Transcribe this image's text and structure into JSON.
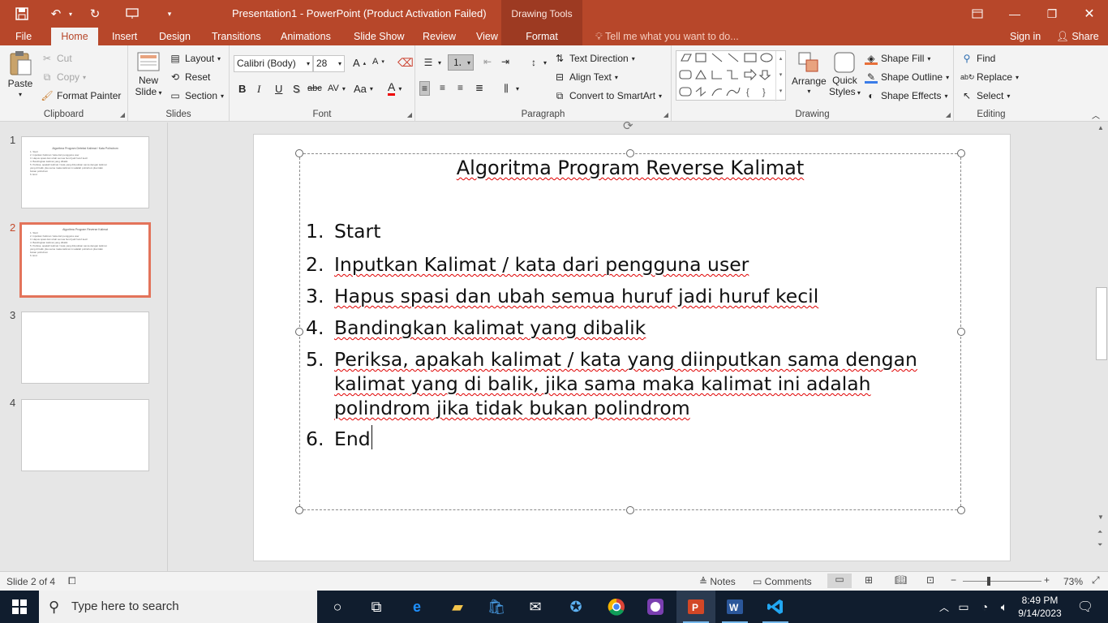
{
  "titlebar": {
    "title": "Presentation1 - PowerPoint (Product Activation Failed)",
    "context_tab_group": "Drawing Tools"
  },
  "tabs": [
    "File",
    "Home",
    "Insert",
    "Design",
    "Transitions",
    "Animations",
    "Slide Show",
    "Review",
    "View",
    "Format"
  ],
  "active_tab": "Home",
  "tell_me": "Tell me what you want to do...",
  "signin": "Sign in",
  "share": "Share",
  "ribbon": {
    "clipboard": {
      "label": "Clipboard",
      "paste": "Paste",
      "cut": "Cut",
      "copy": "Copy",
      "format_painter": "Format Painter"
    },
    "slides": {
      "label": "Slides",
      "new_slide_1": "New",
      "new_slide_2": "Slide",
      "layout": "Layout",
      "reset": "Reset",
      "section": "Section"
    },
    "font": {
      "label": "Font",
      "font_name": "Calibri (Body)",
      "font_size": "28",
      "bold": "B",
      "italic": "I",
      "underline": "U",
      "shadow": "S",
      "strike": "abc",
      "spacing": "AV",
      "case": "Aa",
      "color": "A",
      "grow": "A",
      "shrink": "A"
    },
    "paragraph": {
      "label": "Paragraph",
      "text_direction": "Text Direction",
      "align_text": "Align Text",
      "convert_smartart": "Convert to SmartArt"
    },
    "drawing": {
      "label": "Drawing",
      "arrange": "Arrange",
      "quick_styles_1": "Quick",
      "quick_styles_2": "Styles",
      "shape_fill": "Shape Fill",
      "shape_outline": "Shape Outline",
      "shape_effects": "Shape Effects"
    },
    "editing": {
      "label": "Editing",
      "find": "Find",
      "replace": "Replace",
      "select": "Select"
    }
  },
  "thumbnails": [
    {
      "num": "1",
      "title": "Algoritma Program Deteksi Kalimat / Kata Polindrom",
      "lines": [
        "1. Start",
        "2. Inputkan Kalimat / kata dari pengguna user",
        "3. Hapus spasi dan ubah semua huruf jadi huruf kecil",
        "4. Bandingkan kalimat yang dibalik",
        "5. Periksa, apakah kalimat / kata yang diinputkan sama dengan kalimat",
        "   yang di balik, jika sama maka kalimat ini adalah polindrom jika tidak",
        "   bukan polindrom",
        "6. End"
      ]
    },
    {
      "num": "2",
      "title": "Algoritma Program Reverse Kalimat",
      "lines": [
        "1. Start",
        "2. Inputkan Kalimat / kata dari pengguna user",
        "3. Hapus spasi dan ubah semua huruf jadi huruf kecil",
        "4. Bandingkan kalimat yang dibalik",
        "5. Periksa, apakah kalimat / kata yang diinputkan sama dengan kalimat",
        "   yang di balik, jika sama maka kalimat ini adalah polindrom jika tidak",
        "   bukan polindrom",
        "6. End"
      ]
    },
    {
      "num": "3",
      "title": "",
      "lines": []
    },
    {
      "num": "4",
      "title": "",
      "lines": []
    }
  ],
  "slide": {
    "title": "Algoritma Program Reverse Kalimat",
    "items": [
      {
        "num": "1.",
        "text": "Start"
      },
      {
        "num": "2.",
        "text": "Inputkan Kalimat / kata dari pengguna user"
      },
      {
        "num": "3.",
        "text": "Hapus spasi dan ubah semua huruf jadi huruf kecil"
      },
      {
        "num": "4.",
        "text": "Bandingkan kalimat yang dibalik"
      },
      {
        "num": "5.",
        "text": "Periksa, apakah kalimat / kata yang diinputkan sama dengan kalimat yang di balik, jika sama maka kalimat ini adalah polindrom jika tidak bukan polindrom"
      },
      {
        "num": "6.",
        "text": "End"
      }
    ]
  },
  "statusbar": {
    "slide_count": "Slide 2 of 4",
    "notes": "Notes",
    "comments": "Comments",
    "zoom": "73%"
  },
  "taskbar": {
    "search_placeholder": "Type here to search",
    "time": "8:49 PM",
    "date": "9/14/2023"
  },
  "colors": {
    "accent": "#b7472a",
    "selection": "#e3735a",
    "taskbar": "#101d2e"
  }
}
